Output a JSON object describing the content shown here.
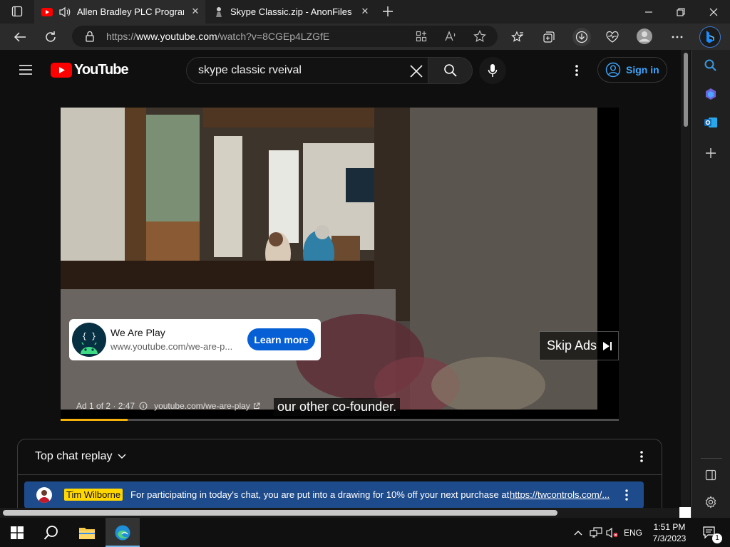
{
  "browser": {
    "tabs": [
      {
        "title": "Allen Bradley PLC Programm",
        "active": true,
        "icon": "youtube-icon"
      },
      {
        "title": "Skype Classic.zip - AnonFiles",
        "active": false,
        "icon": "anonfiles-icon"
      }
    ],
    "url_prefix": "https://",
    "url_domain": "www.youtube.com",
    "url_path": "/watch?v=8CGEp4LZGfE"
  },
  "youtube": {
    "logo_text": "YouTube",
    "search_value": "skype classic rveival",
    "signin_label": "Sign in"
  },
  "ad": {
    "advertiser": "We Are Play",
    "advertiser_url": "www.youtube.com/we-are-p...",
    "learn_more": "Learn more",
    "skip_label": "Skip Ads",
    "ad_info": "Ad 1 of 2 · 2:47",
    "ad_url": "youtube.com/we-are-play",
    "caption": "our other co-founder.",
    "progress": 0.12
  },
  "chat": {
    "header": "Top chat replay",
    "author": "Tim Wilborne",
    "message": "For participating in today's chat, you are put into a drawing for 10% off your next purchase at",
    "link": "https://twcontrols.com/..."
  },
  "taskbar": {
    "lang": "ENG",
    "time": "1:51 PM",
    "date": "7/3/2023",
    "notification_count": "1"
  },
  "colors": {
    "accent_blue": "#065fd4",
    "signin_blue": "#3ea6ff",
    "progress_yellow": "#f6b20c",
    "author_badge": "#ffd600",
    "chat_highlight": "#1e4b8c"
  }
}
